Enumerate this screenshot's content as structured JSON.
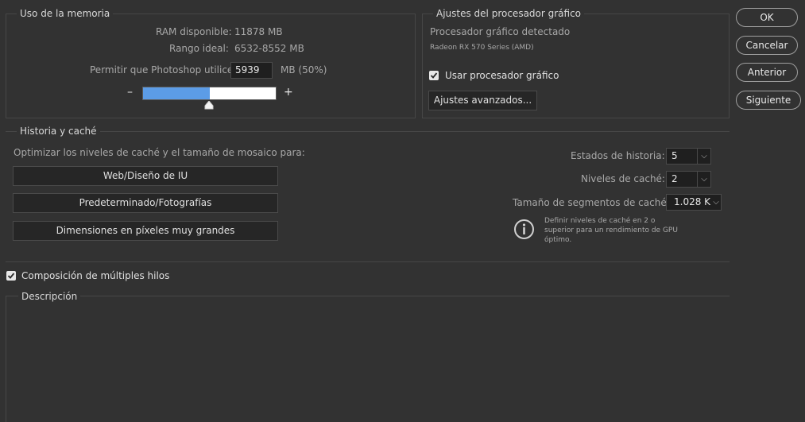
{
  "memory": {
    "legend": "Uso de la memoria",
    "ram_label": "RAM disponible:",
    "ram_value": "11878 MB",
    "range_label": "Rango ideal:",
    "range_value": "6532-8552 MB",
    "allow_label": "Permitir que Photoshop utilice:",
    "allow_value": "5939",
    "allow_unit": "MB (50%)",
    "minus": "–",
    "plus": "+",
    "slider_fraction": 0.5
  },
  "gpu": {
    "legend": "Ajustes del procesador gráfico",
    "detected_label": "Procesador gráfico detectado",
    "detected_name": "Radeon RX 570 Series (AMD)",
    "use_gpu_label": "Usar procesador gráfico",
    "use_gpu_checked": true,
    "advanced_label": "Ajustes avanzados..."
  },
  "buttons": {
    "ok": "OK",
    "cancel": "Cancelar",
    "previous": "Anterior",
    "next": "Siguiente"
  },
  "cache": {
    "legend": "Historia y caché",
    "optimize_label": "Optimizar los niveles de caché y el tamaño de mosaico para:",
    "preset_web": "Web/Diseño de IU",
    "preset_default": "Predeterminado/Fotografías",
    "preset_large": "Dimensiones en píxeles muy grandes",
    "history_label": "Estados de historia:",
    "history_value": "5",
    "levels_label": "Niveles de caché:",
    "levels_value": "2",
    "tile_label": "Tamaño de segmentos de caché:",
    "tile_value": "1.028 K",
    "info_text_1": "Definir niveles de caché en 2 o",
    "info_text_2": "superior para un rendimiento de GPU",
    "info_text_3": "óptimo."
  },
  "multithread": {
    "label": "Composición de múltiples hilos",
    "checked": true
  },
  "description": {
    "legend": "Descripción"
  }
}
